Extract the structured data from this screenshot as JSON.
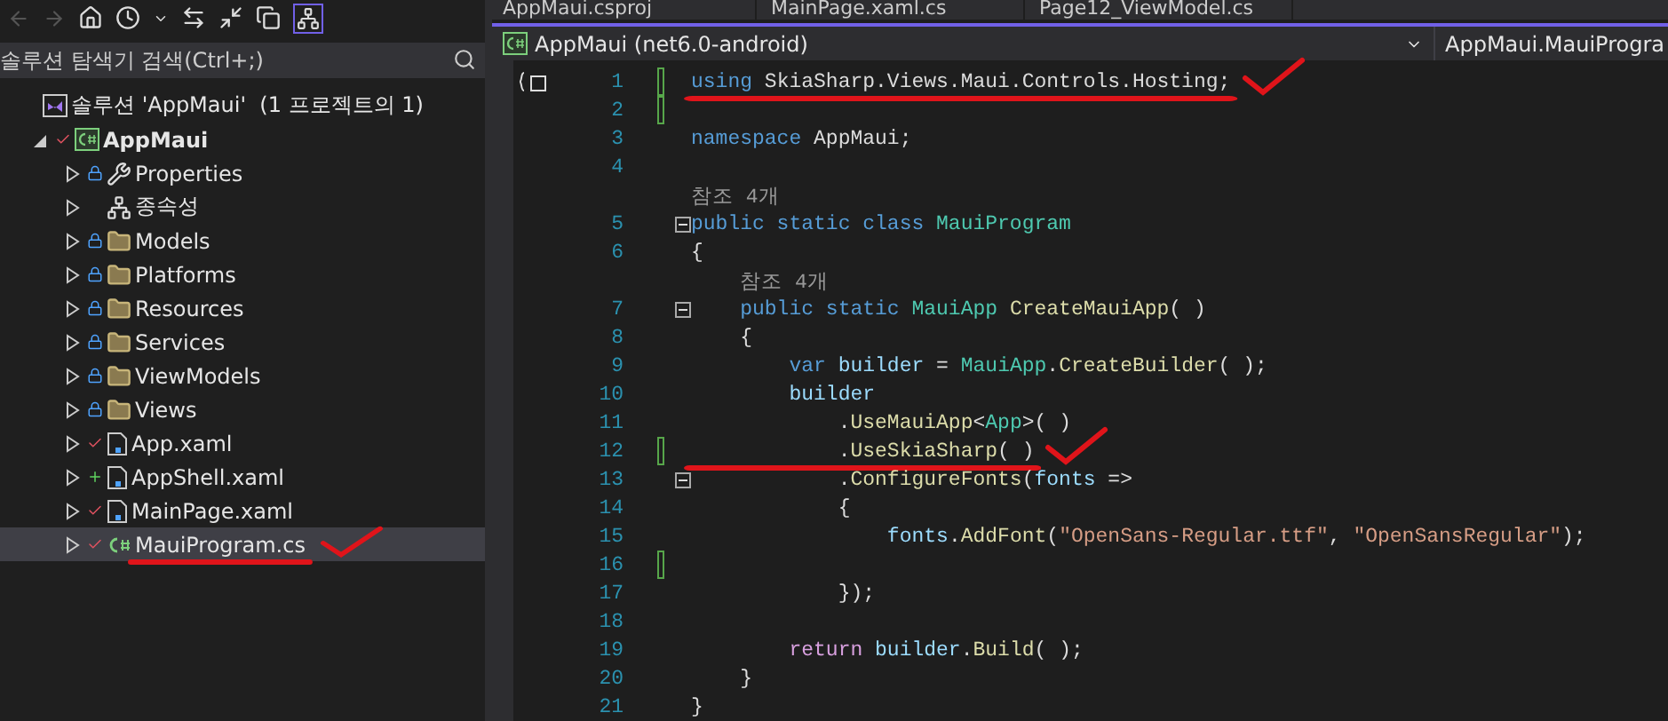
{
  "explorer": {
    "search": {
      "placeholder": "솔루션 탐색기 검색(Ctrl+;)"
    },
    "tree": [
      {
        "label": "솔루션 'AppMaui'  (1 프로젝트의 1)",
        "kind": "solution",
        "selected": false,
        "children": [
          {
            "label": "AppMaui",
            "kind": "project",
            "locked": false,
            "checked": true,
            "added": false,
            "expanded": true,
            "selected": false,
            "annotated": false,
            "children": [
              {
                "label": "Properties",
                "kind": "properties",
                "locked": true,
                "checked": false,
                "added": false,
                "expanded": false,
                "selected": false,
                "annotated": false
              },
              {
                "label": "종속성",
                "kind": "dependencies",
                "locked": false,
                "checked": false,
                "added": false,
                "expanded": false,
                "selected": false,
                "annotated": false
              },
              {
                "label": "Models",
                "kind": "folder",
                "locked": true,
                "checked": false,
                "added": false,
                "expanded": false,
                "selected": false,
                "annotated": false
              },
              {
                "label": "Platforms",
                "kind": "folder",
                "locked": true,
                "checked": false,
                "added": false,
                "expanded": false,
                "selected": false,
                "annotated": false
              },
              {
                "label": "Resources",
                "kind": "folder",
                "locked": true,
                "checked": false,
                "added": false,
                "expanded": false,
                "selected": false,
                "annotated": false
              },
              {
                "label": "Services",
                "kind": "folder",
                "locked": true,
                "checked": false,
                "added": false,
                "expanded": false,
                "selected": false,
                "annotated": false
              },
              {
                "label": "ViewModels",
                "kind": "folder",
                "locked": true,
                "checked": false,
                "added": false,
                "expanded": false,
                "selected": false,
                "annotated": false
              },
              {
                "label": "Views",
                "kind": "folder",
                "locked": true,
                "checked": false,
                "added": false,
                "expanded": false,
                "selected": false,
                "annotated": false
              },
              {
                "label": "App.xaml",
                "kind": "xaml",
                "locked": false,
                "checked": true,
                "added": false,
                "expanded": false,
                "selected": false,
                "annotated": false
              },
              {
                "label": "AppShell.xaml",
                "kind": "xaml",
                "locked": false,
                "checked": false,
                "added": true,
                "expanded": false,
                "selected": false,
                "annotated": false
              },
              {
                "label": "MainPage.xaml",
                "kind": "xaml",
                "locked": false,
                "checked": true,
                "added": false,
                "expanded": false,
                "selected": false,
                "annotated": false
              },
              {
                "label": "MauiProgram.cs",
                "kind": "csharp",
                "locked": false,
                "checked": true,
                "added": false,
                "expanded": false,
                "selected": true,
                "annotated": true
              }
            ]
          }
        ]
      }
    ]
  },
  "editor": {
    "tabs": [
      {
        "label": "AppMaui.csproj",
        "selected": false
      },
      {
        "label": "MainPage.xaml.cs",
        "selected": false
      },
      {
        "label": "Page12_ViewModel.cs",
        "selected": false
      }
    ],
    "project_combo": "AppMaui (net6.0-android)",
    "member_combo": "AppMaui.MauiProgra",
    "lines": [
      {
        "kind": "code",
        "number": "1",
        "modified": true,
        "fold": false,
        "annotated": true,
        "tokens": [
          {
            "text": "using",
            "kind": "keyword"
          },
          {
            "text": " SkiaSharp.Views.Maui.Controls.Hosting;",
            "kind": "plain"
          }
        ]
      },
      {
        "kind": "code",
        "number": "2",
        "modified": true,
        "fold": false,
        "annotated": false
      },
      {
        "kind": "code",
        "number": "3",
        "modified": false,
        "fold": false,
        "annotated": false,
        "tokens": [
          {
            "text": "namespace",
            "kind": "keyword"
          },
          {
            "text": " AppMaui;",
            "kind": "plain"
          }
        ]
      },
      {
        "kind": "code",
        "number": "4",
        "modified": false,
        "fold": false,
        "annotated": false
      },
      {
        "kind": "reference",
        "text": "참조 4개"
      },
      {
        "kind": "code",
        "number": "5",
        "modified": false,
        "fold": true,
        "annotated": false,
        "tokens": [
          {
            "text": "public static class",
            "kind": "keyword"
          },
          {
            "text": " MauiProgram",
            "kind": "type"
          }
        ]
      },
      {
        "kind": "code",
        "number": "6",
        "modified": false,
        "fold": false,
        "annotated": false,
        "tokens": [
          {
            "text": "{",
            "kind": "plain"
          }
        ]
      },
      {
        "kind": "reference",
        "text": "    참조 4개"
      },
      {
        "kind": "code",
        "number": "7",
        "modified": false,
        "fold": true,
        "annotated": false,
        "tokens": [
          {
            "text": "    public static",
            "kind": "keyword"
          },
          {
            "text": " MauiApp",
            "kind": "type"
          },
          {
            "text": " CreateMauiApp",
            "kind": "method"
          },
          {
            "text": "( )",
            "kind": "plain"
          }
        ]
      },
      {
        "kind": "code",
        "number": "8",
        "modified": false,
        "fold": false,
        "annotated": false,
        "tokens": [
          {
            "text": "    {",
            "kind": "plain"
          }
        ]
      },
      {
        "kind": "code",
        "number": "9",
        "modified": false,
        "fold": false,
        "annotated": false,
        "tokens": [
          {
            "text": "        var",
            "kind": "keyword"
          },
          {
            "text": " builder",
            "kind": "local"
          },
          {
            "text": " = ",
            "kind": "plain"
          },
          {
            "text": "MauiApp",
            "kind": "type"
          },
          {
            "text": ".",
            "kind": "plain"
          },
          {
            "text": "CreateBuilder",
            "kind": "method"
          },
          {
            "text": "( );",
            "kind": "plain"
          }
        ]
      },
      {
        "kind": "code",
        "number": "10",
        "modified": false,
        "fold": false,
        "annotated": false,
        "tokens": [
          {
            "text": "        builder",
            "kind": "local"
          }
        ]
      },
      {
        "kind": "code",
        "number": "11",
        "modified": false,
        "fold": false,
        "annotated": false,
        "tokens": [
          {
            "text": "            .",
            "kind": "plain"
          },
          {
            "text": "UseMauiApp",
            "kind": "method"
          },
          {
            "text": "<",
            "kind": "plain"
          },
          {
            "text": "App",
            "kind": "type"
          },
          {
            "text": ">( )",
            "kind": "plain"
          }
        ]
      },
      {
        "kind": "code",
        "number": "12",
        "modified": true,
        "fold": false,
        "annotated": true,
        "tokens": [
          {
            "text": "            .",
            "kind": "plain"
          },
          {
            "text": "UseSkiaSharp",
            "kind": "method"
          },
          {
            "text": "( )",
            "kind": "plain"
          }
        ]
      },
      {
        "kind": "code",
        "number": "13",
        "modified": false,
        "fold": true,
        "annotated": false,
        "tokens": [
          {
            "text": "            .",
            "kind": "plain"
          },
          {
            "text": "ConfigureFonts",
            "kind": "method"
          },
          {
            "text": "(",
            "kind": "plain"
          },
          {
            "text": "fonts",
            "kind": "local"
          },
          {
            "text": " =>",
            "kind": "plain"
          }
        ]
      },
      {
        "kind": "code",
        "number": "14",
        "modified": false,
        "fold": false,
        "annotated": false,
        "tokens": [
          {
            "text": "            {",
            "kind": "plain"
          }
        ]
      },
      {
        "kind": "code",
        "number": "15",
        "modified": false,
        "fold": false,
        "annotated": false,
        "tokens": [
          {
            "text": "                fonts",
            "kind": "local"
          },
          {
            "text": ".",
            "kind": "plain"
          },
          {
            "text": "AddFont",
            "kind": "method"
          },
          {
            "text": "(",
            "kind": "plain"
          },
          {
            "text": "\"OpenSans-Regular.ttf\"",
            "kind": "string"
          },
          {
            "text": ", ",
            "kind": "plain"
          },
          {
            "text": "\"OpenSansRegular\"",
            "kind": "string"
          },
          {
            "text": ");",
            "kind": "plain"
          }
        ]
      },
      {
        "kind": "code",
        "number": "16",
        "modified": true,
        "fold": false,
        "annotated": false
      },
      {
        "kind": "code",
        "number": "17",
        "modified": false,
        "fold": false,
        "annotated": false,
        "tokens": [
          {
            "text": "            });",
            "kind": "plain"
          }
        ]
      },
      {
        "kind": "code",
        "number": "18",
        "modified": false,
        "fold": false,
        "annotated": false
      },
      {
        "kind": "code",
        "number": "19",
        "modified": false,
        "fold": false,
        "annotated": false,
        "tokens": [
          {
            "text": "        return",
            "kind": "control"
          },
          {
            "text": " builder",
            "kind": "local"
          },
          {
            "text": ".",
            "kind": "plain"
          },
          {
            "text": "Build",
            "kind": "method"
          },
          {
            "text": "( );",
            "kind": "plain"
          }
        ]
      },
      {
        "kind": "code",
        "number": "20",
        "modified": false,
        "fold": false,
        "annotated": false,
        "tokens": [
          {
            "text": "    }",
            "kind": "plain"
          }
        ]
      },
      {
        "kind": "code",
        "number": "21",
        "modified": false,
        "fold": false,
        "annotated": false,
        "tokens": [
          {
            "text": "}",
            "kind": "plain"
          }
        ]
      }
    ]
  }
}
